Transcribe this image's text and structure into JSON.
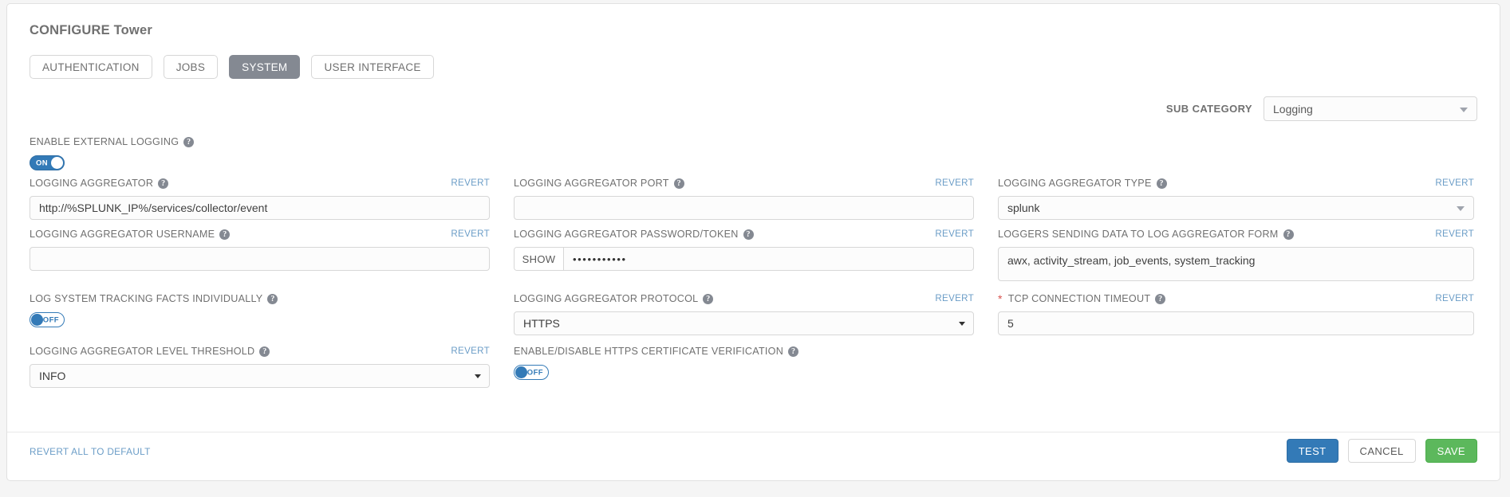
{
  "header": {
    "title_strong": "CONFIGURE",
    "title_rest": " Tower",
    "tabs": [
      {
        "label": "AUTHENTICATION",
        "active": false
      },
      {
        "label": "JOBS",
        "active": false
      },
      {
        "label": "SYSTEM",
        "active": true
      },
      {
        "label": "USER INTERFACE",
        "active": false
      }
    ]
  },
  "subcategory": {
    "label": "SUB CATEGORY",
    "value": "Logging",
    "icon": "chevron-down-icon"
  },
  "common": {
    "revert": "REVERT",
    "help_icon": "question-mark-icon",
    "required_marker": "*"
  },
  "fields": {
    "enable_external_logging": {
      "label": "ENABLE EXTERNAL LOGGING",
      "toggle_state": "ON"
    },
    "logging_aggregator": {
      "label": "LOGGING AGGREGATOR",
      "value": "http://%SPLUNK_IP%/services/collector/event",
      "revert": "REVERT"
    },
    "logging_aggregator_port": {
      "label": "LOGGING AGGREGATOR PORT",
      "value": "",
      "revert": "REVERT"
    },
    "logging_aggregator_type": {
      "label": "LOGGING AGGREGATOR TYPE",
      "value": "splunk",
      "revert": "REVERT"
    },
    "logging_aggregator_username": {
      "label": "LOGGING AGGREGATOR USERNAME",
      "value": "",
      "revert": "REVERT"
    },
    "logging_aggregator_password": {
      "label": "LOGGING AGGREGATOR PASSWORD/TOKEN",
      "show_button": "SHOW",
      "value": "•••••••••••",
      "revert": "REVERT"
    },
    "loggers_sending_data": {
      "label": "LOGGERS SENDING DATA TO LOG AGGREGATOR FORM",
      "value": "awx, activity_stream, job_events, system_tracking",
      "revert": "REVERT"
    },
    "log_system_tracking_facts": {
      "label": "LOG SYSTEM TRACKING FACTS INDIVIDUALLY",
      "toggle_state": "OFF"
    },
    "logging_aggregator_protocol": {
      "label": "LOGGING AGGREGATOR PROTOCOL",
      "value": "HTTPS",
      "revert": "REVERT"
    },
    "tcp_connection_timeout": {
      "label": "TCP CONNECTION TIMEOUT",
      "value": "5",
      "revert": "REVERT",
      "required": true
    },
    "logging_aggregator_level_threshold": {
      "label": "LOGGING AGGREGATOR LEVEL THRESHOLD",
      "value": "INFO",
      "revert": "REVERT"
    },
    "https_certificate_verification": {
      "label": "ENABLE/DISABLE HTTPS CERTIFICATE VERIFICATION",
      "toggle_state": "OFF"
    }
  },
  "footer": {
    "revert_all": "REVERT ALL TO DEFAULT",
    "test": "TEST",
    "cancel": "CANCEL",
    "save": "SAVE"
  },
  "colors": {
    "accent_blue": "#337ab7",
    "link_blue": "#6b9dc7",
    "active_tab_gray": "#848992",
    "save_green": "#5cb85c",
    "required_red": "#d9534f"
  }
}
